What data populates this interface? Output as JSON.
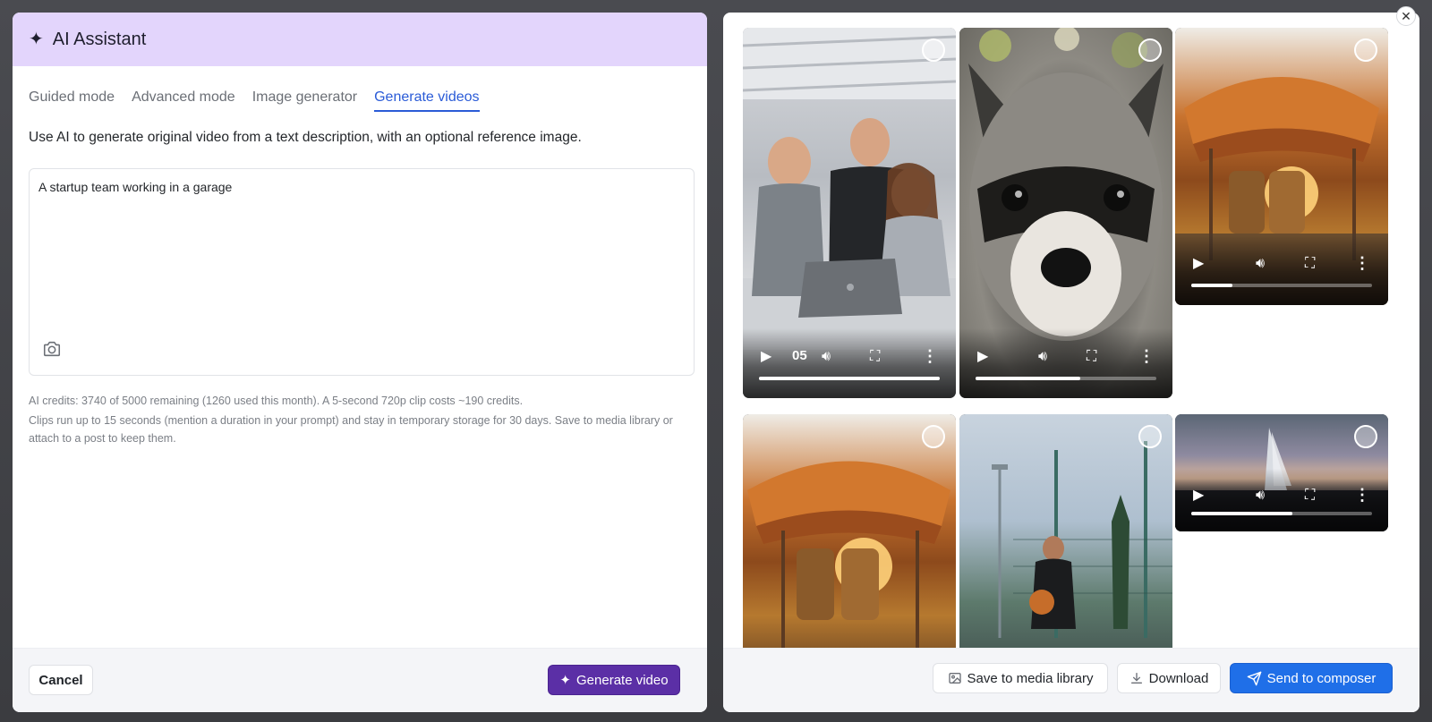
{
  "assistant": {
    "title": "AI Assistant",
    "header_icon": "sparkle-icon",
    "tabs": [
      {
        "label": "Guided mode",
        "active": false
      },
      {
        "label": "Advanced mode",
        "active": false
      },
      {
        "label": "Image generator",
        "active": false
      },
      {
        "label": "Generate videos",
        "active": true
      }
    ],
    "description": "Use AI to generate original video from a text description, with an optional reference image.",
    "prompt": {
      "value": "A startup team working in a garage",
      "attach_icon": "camera-icon"
    },
    "credits_note": "AI credits: 3740 of 5000 remaining (1260 used this month). A 5-second 720p clip costs ~190 credits.",
    "storage_note": "Clips run up to 15 seconds (mention a duration in your prompt) and stay in temporary storage for 30 days. Save to media library or attach to a post to keep them.",
    "footer": {
      "cancel_label": "Cancel",
      "generate_label": "Generate video",
      "generate_icon": "sparkle-icon"
    },
    "colors": {
      "header_bg": "#e3d5fc",
      "accent": "#2a5bd7",
      "generate_bg": "#5b2fa6"
    }
  },
  "gallery": {
    "videos": [
      {
        "subject": "startup team in garage",
        "time": "05",
        "progress": 1.0,
        "selected": false
      },
      {
        "subject": "raccoon close-up",
        "time": "",
        "progress": 0.58,
        "selected": false
      },
      {
        "subject": "lantern stand at sunset",
        "time": "",
        "progress": 0.23,
        "selected": false
      },
      {
        "subject": "lantern stand at sunset",
        "time": "",
        "progress": null,
        "selected": false
      },
      {
        "subject": "basketball player on court",
        "time": "",
        "progress": null,
        "selected": false
      },
      {
        "subject": "sailboat at dusk",
        "time": "",
        "progress": 0.56,
        "selected": false
      }
    ],
    "footer": {
      "save_label": "Save to media library",
      "download_label": "Download",
      "send_label": "Send to composer"
    },
    "colors": {
      "send_bg": "#1f6fe8"
    }
  }
}
